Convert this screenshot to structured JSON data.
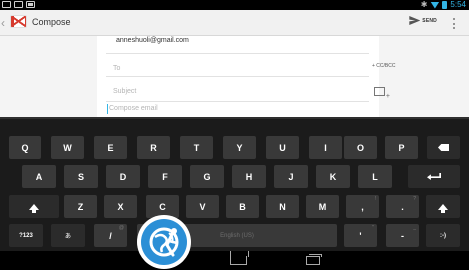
{
  "status_bar": {
    "icons": [
      "gmail-notification-icon",
      "image-notification-icon",
      "bluetooth-icon",
      "wifi-icon",
      "battery-icon"
    ],
    "time": "5:54"
  },
  "action_bar": {
    "title": "Compose",
    "send_label": "SEND"
  },
  "compose": {
    "from_value": "anneshuoli@gmail.com",
    "to_placeholder": "To",
    "cc_bcc_label": "+ CC/BCC",
    "subject_placeholder": "Subject",
    "body_placeholder": "Compose email"
  },
  "keyboard": {
    "row1": [
      "Q",
      "W",
      "E",
      "R",
      "T",
      "Y",
      "U",
      "I",
      "O",
      "P"
    ],
    "row2": [
      "A",
      "S",
      "D",
      "F",
      "G",
      "H",
      "J",
      "K",
      "L"
    ],
    "row3": [
      "Z",
      "X",
      "C",
      "V",
      "B",
      "N",
      "M",
      ",",
      "."
    ],
    "row3_hints": [
      "!",
      "?"
    ],
    "row4": {
      "symbols_label": "?123",
      "lang_label": "あ",
      "slash_label": "/",
      "slash_hint": "@",
      "space_label": "English (US)",
      "apostrophe_label": "'",
      "apostrophe_hint": "\"",
      "dash_label": "-",
      "dash_hint": "_",
      "smiley_label": ":-)"
    }
  },
  "colors": {
    "accent": "#33b5e5",
    "gmail_red": "#d63b2f",
    "badge_blue": "#2b8fd6"
  }
}
